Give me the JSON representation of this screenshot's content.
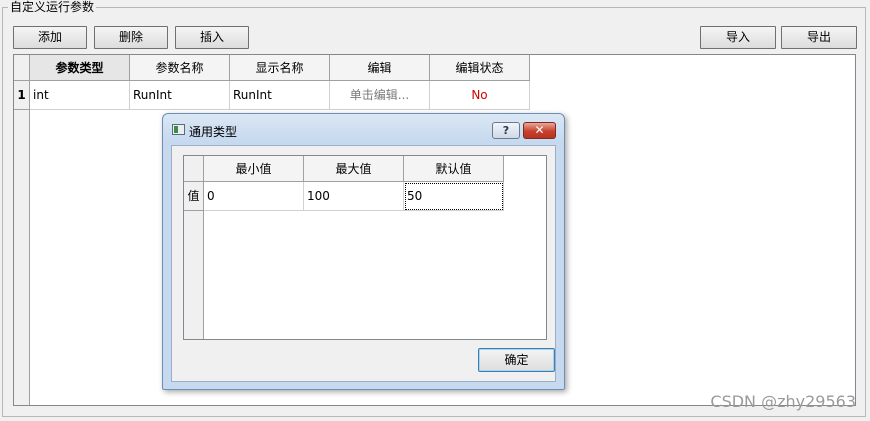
{
  "group": {
    "title": "自定义运行参数"
  },
  "toolbar": {
    "add_label": "添加",
    "delete_label": "删除",
    "insert_label": "插入",
    "import_label": "导入",
    "export_label": "导出"
  },
  "params_table": {
    "headers": [
      "参数类型",
      "参数名称",
      "显示名称",
      "编辑",
      "编辑状态"
    ],
    "rows": [
      {
        "row_header": "1",
        "type": "int",
        "name": "RunInt",
        "display_name": "RunInt",
        "edit": "单击编辑...",
        "edit_status": "No"
      }
    ]
  },
  "dialog": {
    "title": "通用类型",
    "help_label": "?",
    "close_label": "✕",
    "headers": [
      "最小值",
      "最大值",
      "默认值"
    ],
    "row_header": "值",
    "values": {
      "min": "0",
      "max": "100",
      "default": "50"
    },
    "ok_label": "确定"
  },
  "watermark": "CSDN @zhy29563",
  "colors": {
    "status_no": "#d40000",
    "dialog_frame": "#c6d9ef",
    "close_button": "#c7412d"
  }
}
